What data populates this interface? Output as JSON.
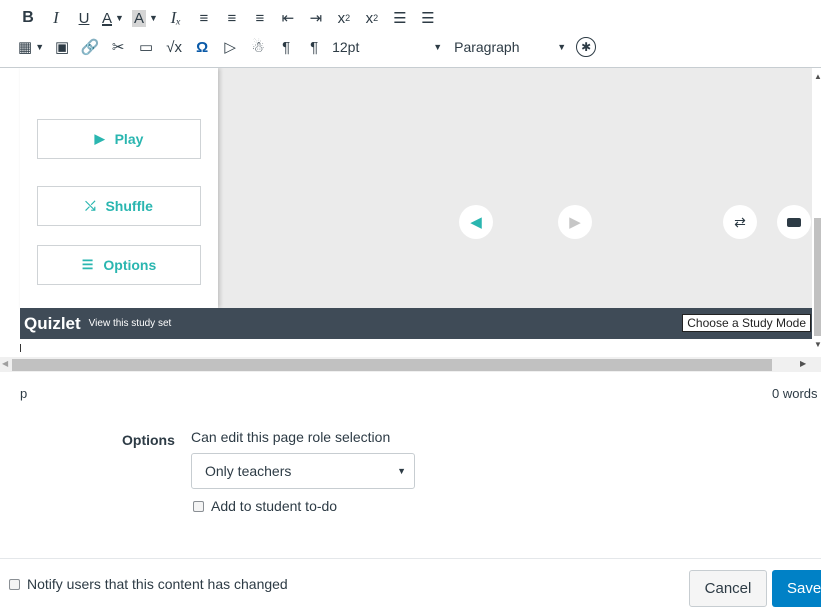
{
  "toolbar": {
    "row1": [
      {
        "label": "B",
        "name": "bold-button",
        "cls": "tb-b"
      },
      {
        "label": "I",
        "name": "italic-button",
        "cls": "tb-i"
      },
      {
        "label": "U",
        "name": "underline-button",
        "cls": "tb-u"
      },
      {
        "label": "A",
        "name": "text-color-button",
        "cls": "tb-A",
        "caret": true
      },
      {
        "label": "A",
        "name": "background-color-button",
        "cls": "tb-Abg",
        "caret": true
      },
      {
        "label": "Iₓ",
        "name": "clear-formatting-button",
        "cls": "tb-i"
      },
      {
        "label": "≡",
        "name": "align-left-button"
      },
      {
        "label": "≡",
        "name": "align-center-button"
      },
      {
        "label": "≡",
        "name": "align-right-button"
      },
      {
        "label": "⇤",
        "name": "outdent-button"
      },
      {
        "label": "⇥",
        "name": "indent-button"
      }
    ],
    "row1_superscript": "x",
    "row1_subscript": "x",
    "row1_lists": [
      "☰",
      "☰"
    ],
    "row2_icons": [
      {
        "icon": "▦",
        "name": "table-icon",
        "caret": true
      },
      {
        "icon": "▣",
        "name": "media-icon"
      },
      {
        "icon": "🔗",
        "name": "link-icon"
      },
      {
        "icon": "✂",
        "name": "unlink-icon"
      },
      {
        "icon": "▭",
        "name": "image-icon"
      },
      {
        "icon": "√x",
        "name": "equation-icon"
      },
      {
        "icon": "Ω",
        "name": "special-char-icon"
      },
      {
        "icon": "▷",
        "name": "video-icon"
      },
      {
        "icon": "☃",
        "name": "embed-icon"
      },
      {
        "icon": "¶",
        "name": "ltr-icon"
      },
      {
        "icon": "¶",
        "name": "rtl-icon"
      }
    ],
    "font_size": "12pt",
    "block_format": "Paragraph",
    "accessibility_icon": "☯"
  },
  "quizlet": {
    "play": "Play",
    "shuffle": "Shuffle",
    "options": "Options",
    "logo": "Quizlet",
    "view_link": "View this study set",
    "study_mode": "Choose a Study Mode",
    "accent": "#2ab6b0"
  },
  "status": {
    "path": "p",
    "word_count": "0 words"
  },
  "options": {
    "label": "Options",
    "perm_label": "Can edit this page role selection",
    "perm_value": "Only teachers",
    "todo_label": "Add to student to-do"
  },
  "footer": {
    "notify_label": "Notify users that this content has changed",
    "cancel": "Cancel",
    "save": "Save",
    "save_color": "#0081c6"
  }
}
